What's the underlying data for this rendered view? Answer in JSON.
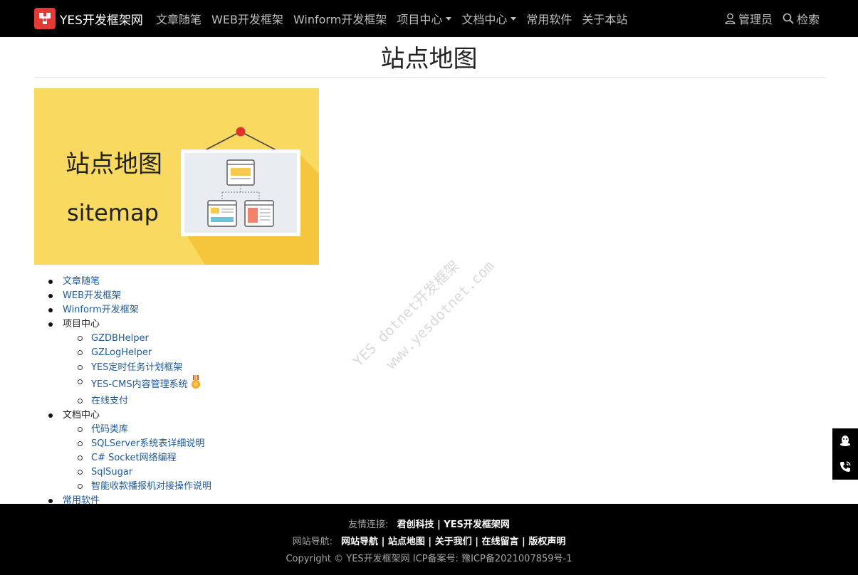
{
  "brand": {
    "name": "YES开发框架网"
  },
  "nav": {
    "items": [
      {
        "label": "文章随笔",
        "dropdown": false
      },
      {
        "label": "WEB开发框架",
        "dropdown": false
      },
      {
        "label": "Winform开发框架",
        "dropdown": false
      },
      {
        "label": "项目中心",
        "dropdown": true
      },
      {
        "label": "文档中心",
        "dropdown": true
      },
      {
        "label": "常用软件",
        "dropdown": false
      },
      {
        "label": "关于本站",
        "dropdown": false
      }
    ],
    "admin_label": "管理员",
    "search_label": "检索"
  },
  "page": {
    "title": "站点地图"
  },
  "banner": {
    "title_cn": "站点地图",
    "title_en": "sitemap"
  },
  "sitemap": {
    "items": [
      {
        "label": "文章随笔",
        "link": true
      },
      {
        "label": "WEB开发框架",
        "link": true
      },
      {
        "label": "Winform开发框架",
        "link": true
      },
      {
        "label": "项目中心",
        "link": false,
        "children": [
          "GZDBHelper",
          "GZLogHelper",
          "YES定时任务计划框架",
          "YES-CMS内容管理系统",
          "在线支付"
        ]
      },
      {
        "label": "文档中心",
        "link": false,
        "children": [
          "代码类库",
          "SQLServer系统表详细说明",
          "C# Socket网络编程",
          "SqlSugar",
          "智能收款播报机对接操作说明"
        ]
      },
      {
        "label": "常用软件",
        "link": true
      }
    ]
  },
  "watermark": {
    "line1": "YES dotnet开发框架",
    "line2": "www.yesdotnet.com"
  },
  "footer": {
    "friends_label": "友情连接:",
    "friends": [
      "君创科技",
      "YES开发框架网"
    ],
    "sitenav_label": "网站导航:",
    "sitenav": [
      "网站导航",
      "站点地图",
      "关于我们",
      "在线留言",
      "版权声明"
    ],
    "copyright": "Copyright © YES开发框架网 ICP备案号: 豫ICP备2021007859号-1"
  },
  "colors": {
    "navbar_bg": "#000000",
    "brand_logo": "#e53935",
    "link": "#1d5b9a",
    "banner_bg": "#f9d95f"
  }
}
